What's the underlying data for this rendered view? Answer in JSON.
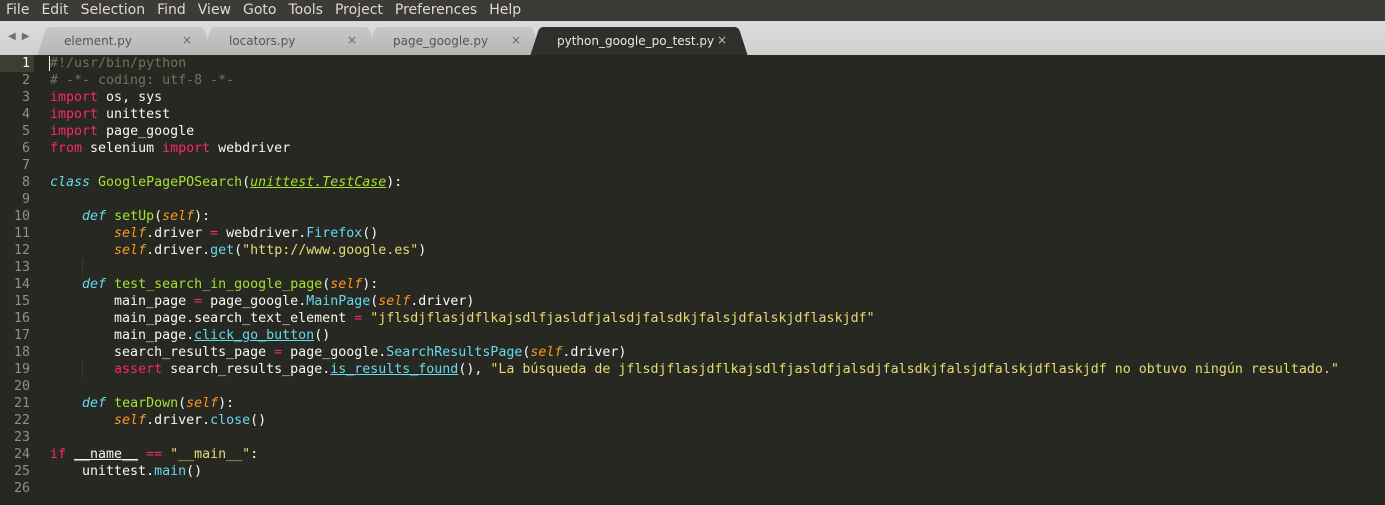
{
  "menu": [
    "File",
    "Edit",
    "Selection",
    "Find",
    "View",
    "Goto",
    "Tools",
    "Project",
    "Preferences",
    "Help"
  ],
  "tabs": [
    {
      "label": "element.py",
      "close": "×",
      "active": false
    },
    {
      "label": "locators.py",
      "close": "×",
      "active": false
    },
    {
      "label": "page_google.py",
      "close": "×",
      "active": false
    },
    {
      "label": "python_google_po_test.py",
      "close": "×",
      "active": true
    }
  ],
  "nav_arrows": {
    "left": "◀",
    "right": "▶"
  },
  "current_line": 1,
  "lines": [
    {
      "n": "1",
      "tokens": [
        {
          "t": "#!/usr/bin/python",
          "c": "c"
        }
      ]
    },
    {
      "n": "2",
      "tokens": [
        {
          "t": "# -*- coding: utf-8 -*-",
          "c": "c"
        }
      ]
    },
    {
      "n": "3",
      "tokens": [
        {
          "t": "import",
          "c": "k"
        },
        {
          "t": " os, sys",
          "c": "n"
        }
      ]
    },
    {
      "n": "4",
      "tokens": [
        {
          "t": "import",
          "c": "k"
        },
        {
          "t": " unittest",
          "c": "n"
        }
      ]
    },
    {
      "n": "5",
      "tokens": [
        {
          "t": "import",
          "c": "k"
        },
        {
          "t": " page_google",
          "c": "n"
        }
      ]
    },
    {
      "n": "6",
      "tokens": [
        {
          "t": "from",
          "c": "k"
        },
        {
          "t": " selenium ",
          "c": "n"
        },
        {
          "t": "import",
          "c": "k"
        },
        {
          "t": " webdriver",
          "c": "n"
        }
      ]
    },
    {
      "n": "7",
      "tokens": []
    },
    {
      "n": "8",
      "tokens": [
        {
          "t": "class",
          "c": "def"
        },
        {
          "t": " ",
          "c": "n"
        },
        {
          "t": "GooglePagePOSearch",
          "c": "cls"
        },
        {
          "t": "(",
          "c": "n"
        },
        {
          "t": "unittest.TestCase",
          "c": "inh"
        },
        {
          "t": "):",
          "c": "n"
        }
      ]
    },
    {
      "n": "9",
      "tokens": []
    },
    {
      "n": "10",
      "tokens": [
        {
          "t": "    ",
          "c": "n"
        },
        {
          "t": "def",
          "c": "def"
        },
        {
          "t": " ",
          "c": "n"
        },
        {
          "t": "setUp",
          "c": "cls"
        },
        {
          "t": "(",
          "c": "n"
        },
        {
          "t": "self",
          "c": "self"
        },
        {
          "t": "):",
          "c": "n"
        }
      ]
    },
    {
      "n": "11",
      "tokens": [
        {
          "t": "        ",
          "c": "n"
        },
        {
          "t": "self",
          "c": "self"
        },
        {
          "t": ".driver ",
          "c": "n"
        },
        {
          "t": "=",
          "c": "k"
        },
        {
          "t": " webdriver.",
          "c": "n"
        },
        {
          "t": "Firefox",
          "c": "f"
        },
        {
          "t": "()",
          "c": "n"
        }
      ]
    },
    {
      "n": "12",
      "tokens": [
        {
          "t": "        ",
          "c": "n"
        },
        {
          "t": "self",
          "c": "self"
        },
        {
          "t": ".driver.",
          "c": "n"
        },
        {
          "t": "get",
          "c": "f"
        },
        {
          "t": "(",
          "c": "n"
        },
        {
          "t": "\"http://www.google.es\"",
          "c": "s"
        },
        {
          "t": ")",
          "c": "n"
        }
      ]
    },
    {
      "n": "13",
      "tokens": []
    },
    {
      "n": "14",
      "tokens": [
        {
          "t": "    ",
          "c": "n"
        },
        {
          "t": "def",
          "c": "def"
        },
        {
          "t": " ",
          "c": "n"
        },
        {
          "t": "test_search_in_google_page",
          "c": "cls"
        },
        {
          "t": "(",
          "c": "n"
        },
        {
          "t": "self",
          "c": "self"
        },
        {
          "t": "):",
          "c": "n"
        }
      ]
    },
    {
      "n": "15",
      "tokens": [
        {
          "t": "        main_page ",
          "c": "n"
        },
        {
          "t": "=",
          "c": "k"
        },
        {
          "t": " page_google.",
          "c": "n"
        },
        {
          "t": "MainPage",
          "c": "f"
        },
        {
          "t": "(",
          "c": "n"
        },
        {
          "t": "self",
          "c": "self"
        },
        {
          "t": ".driver)",
          "c": "n"
        }
      ]
    },
    {
      "n": "16",
      "tokens": [
        {
          "t": "        main_page.search_text_element ",
          "c": "n"
        },
        {
          "t": "=",
          "c": "k"
        },
        {
          "t": " ",
          "c": "n"
        },
        {
          "t": "\"jflsdjflasjdflkajsdlfjasldfjalsdjfalsdkjfalsjdfalskjdflaskjdf\"",
          "c": "s"
        }
      ]
    },
    {
      "n": "17",
      "tokens": [
        {
          "t": "        main_page.",
          "c": "n"
        },
        {
          "t": "click_go_button",
          "c": "fu"
        },
        {
          "t": "()",
          "c": "n"
        }
      ]
    },
    {
      "n": "18",
      "tokens": [
        {
          "t": "        search_results_page ",
          "c": "n"
        },
        {
          "t": "=",
          "c": "k"
        },
        {
          "t": " page_google.",
          "c": "n"
        },
        {
          "t": "SearchResultsPage",
          "c": "f"
        },
        {
          "t": "(",
          "c": "n"
        },
        {
          "t": "self",
          "c": "self"
        },
        {
          "t": ".driver)",
          "c": "n"
        }
      ]
    },
    {
      "n": "19",
      "tokens": [
        {
          "t": "        ",
          "c": "n"
        },
        {
          "t": "assert",
          "c": "k"
        },
        {
          "t": " search_results_page.",
          "c": "n"
        },
        {
          "t": "is_results_found",
          "c": "fu"
        },
        {
          "t": "(), ",
          "c": "n"
        },
        {
          "t": "\"La búsqueda de jflsdjflasjdflkajsdlfjasldfjalsdjfalsdkjfalsjdfalskjdflaskjdf no obtuvo ningún resultado.\"",
          "c": "s"
        }
      ]
    },
    {
      "n": "20",
      "tokens": []
    },
    {
      "n": "21",
      "tokens": [
        {
          "t": "    ",
          "c": "n"
        },
        {
          "t": "def",
          "c": "def"
        },
        {
          "t": " ",
          "c": "n"
        },
        {
          "t": "tearDown",
          "c": "cls"
        },
        {
          "t": "(",
          "c": "n"
        },
        {
          "t": "self",
          "c": "self"
        },
        {
          "t": "):",
          "c": "n"
        }
      ]
    },
    {
      "n": "22",
      "tokens": [
        {
          "t": "        ",
          "c": "n"
        },
        {
          "t": "self",
          "c": "self"
        },
        {
          "t": ".driver.",
          "c": "n"
        },
        {
          "t": "close",
          "c": "f"
        },
        {
          "t": "()",
          "c": "n"
        }
      ]
    },
    {
      "n": "23",
      "tokens": []
    },
    {
      "n": "24",
      "tokens": [
        {
          "t": "if",
          "c": "k"
        },
        {
          "t": " ",
          "c": "n"
        },
        {
          "t": "__name__",
          "c": "ul"
        },
        {
          "t": " ",
          "c": "n"
        },
        {
          "t": "==",
          "c": "k"
        },
        {
          "t": " ",
          "c": "n"
        },
        {
          "t": "\"__main__\"",
          "c": "s"
        },
        {
          "t": ":",
          "c": "n"
        }
      ]
    },
    {
      "n": "25",
      "tokens": [
        {
          "t": "    unittest.",
          "c": "n"
        },
        {
          "t": "main",
          "c": "f"
        },
        {
          "t": "()",
          "c": "n"
        }
      ]
    },
    {
      "n": "26",
      "tokens": []
    }
  ]
}
